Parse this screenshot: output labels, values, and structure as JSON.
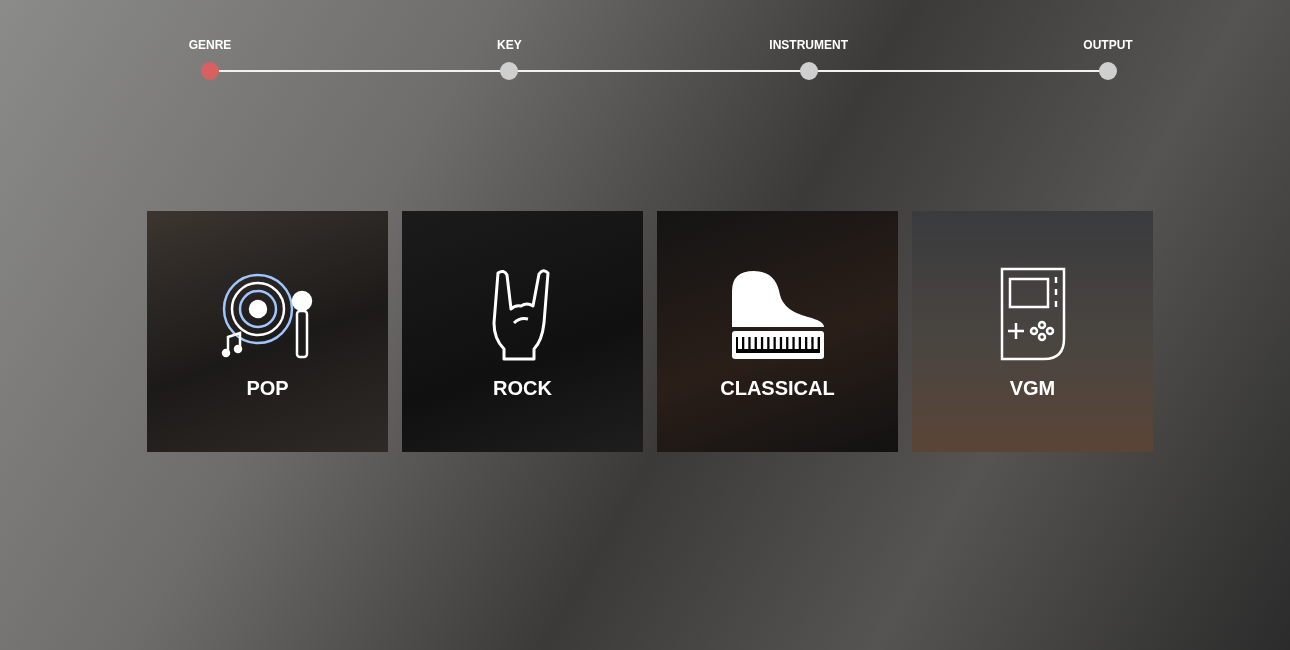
{
  "steps": [
    {
      "label": "GENRE",
      "selected": true
    },
    {
      "label": "KEY",
      "selected": false
    },
    {
      "label": "INSTRUMENT",
      "selected": false
    },
    {
      "label": "OUTPUT",
      "selected": false
    }
  ],
  "genres": [
    {
      "kind": "pop",
      "label": "POP"
    },
    {
      "kind": "rock",
      "label": "ROCK"
    },
    {
      "kind": "classical",
      "label": "CLASSICAL"
    },
    {
      "kind": "vgm",
      "label": "VGM"
    }
  ]
}
